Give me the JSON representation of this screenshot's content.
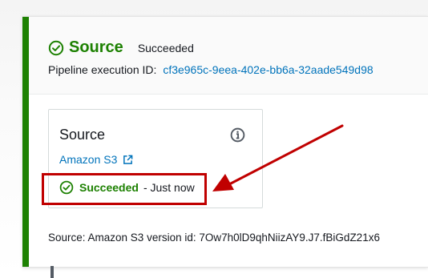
{
  "stage": {
    "name": "Source",
    "status": "Succeeded",
    "execution_label": "Pipeline execution ID:",
    "execution_id": "cf3e965c-9eea-402e-bb6a-32aade549d98"
  },
  "action": {
    "name": "Source",
    "provider": "Amazon S3",
    "status": "Succeeded",
    "time": "- Just now"
  },
  "revision": {
    "text": "Source: Amazon S3 version id: 7Ow7h0lD9qhNiizAY9.J7.fBiGdZ21x6"
  },
  "icons": {
    "stage_status": "check-circle-icon",
    "action_status": "check-circle-icon",
    "info": "info-icon",
    "external_link": "external-link-icon"
  },
  "colors": {
    "success": "#1d8102",
    "link": "#0073bb",
    "annotation": "#c00000"
  }
}
